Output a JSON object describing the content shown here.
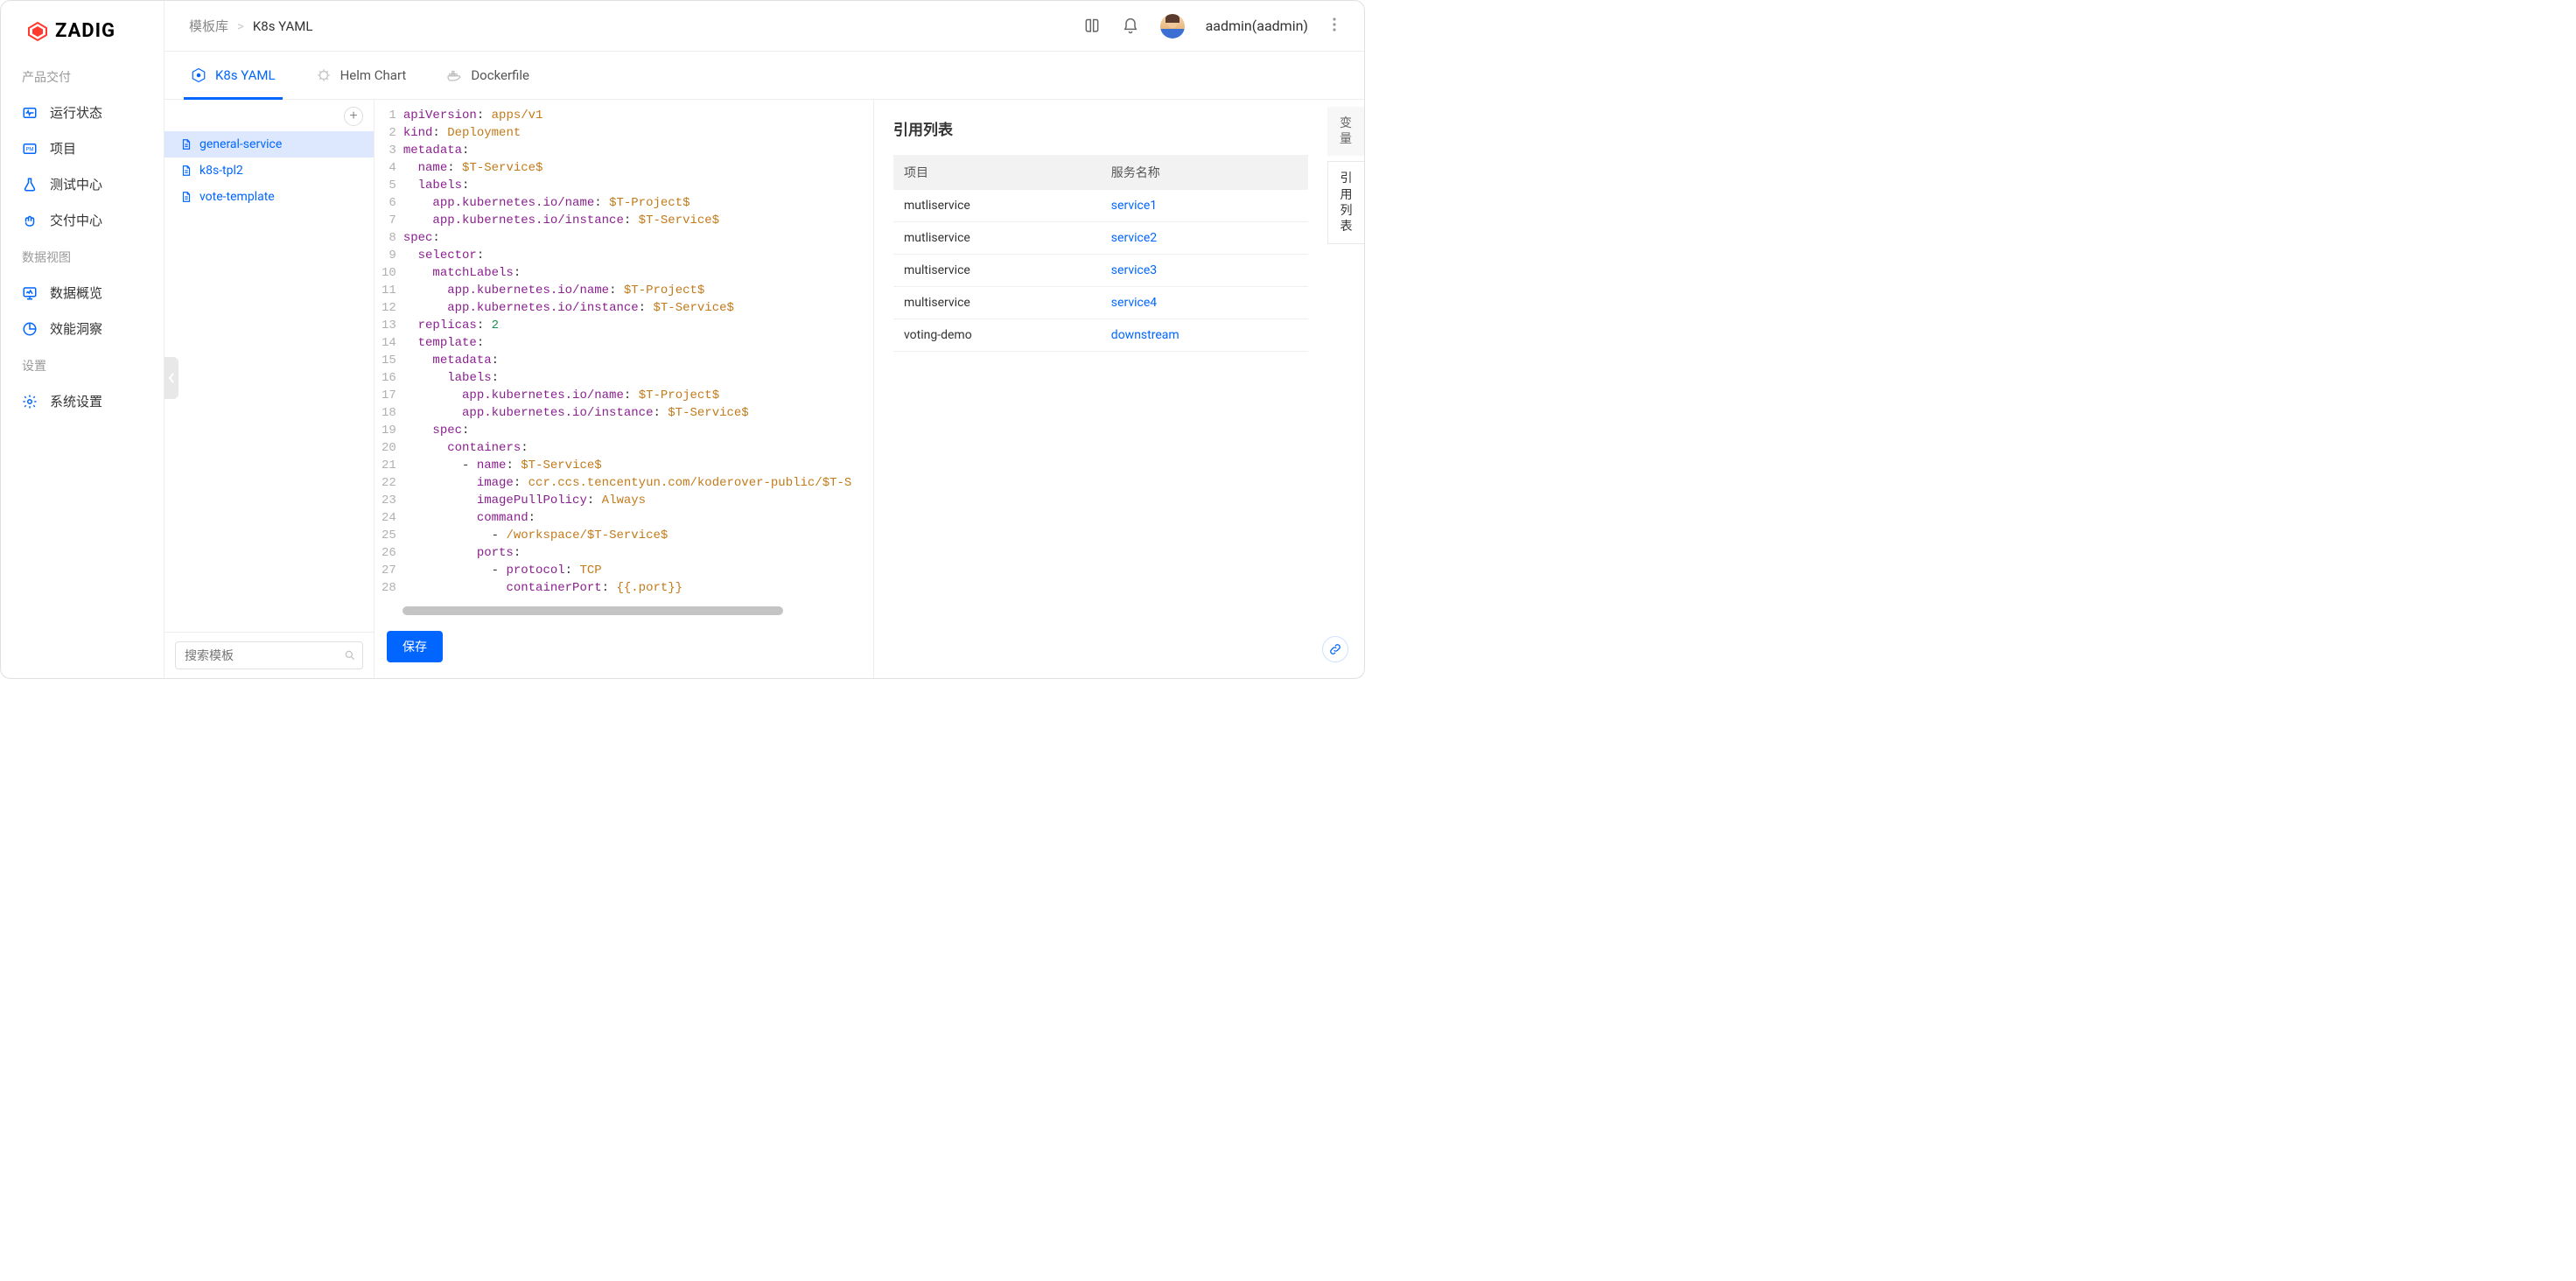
{
  "logo": {
    "text": "ZADIG"
  },
  "breadcrumb": {
    "root": "模板库",
    "current": "K8s YAML"
  },
  "topbar": {
    "username": "aadmin(aadmin)"
  },
  "sidebar": {
    "sections": [
      {
        "title": "产品交付",
        "items": [
          {
            "icon": "heartbeat",
            "label": "运行状态"
          },
          {
            "icon": "project",
            "label": "项目"
          },
          {
            "icon": "flask",
            "label": "测试中心"
          },
          {
            "icon": "hands",
            "label": "交付中心"
          }
        ]
      },
      {
        "title": "数据视图",
        "items": [
          {
            "icon": "monitor",
            "label": "数据概览"
          },
          {
            "icon": "pie",
            "label": "效能洞察"
          }
        ]
      },
      {
        "title": "设置",
        "items": [
          {
            "icon": "gear",
            "label": "系统设置"
          }
        ]
      }
    ]
  },
  "tabs": [
    {
      "icon": "k8s",
      "label": "K8s YAML",
      "active": true
    },
    {
      "icon": "helm",
      "label": "Helm Chart",
      "active": false
    },
    {
      "icon": "docker",
      "label": "Dockerfile",
      "active": false
    }
  ],
  "templates": {
    "items": [
      {
        "name": "general-service",
        "selected": true
      },
      {
        "name": "k8s-tpl2",
        "selected": false
      },
      {
        "name": "vote-template",
        "selected": false
      }
    ],
    "search_placeholder": "搜索模板"
  },
  "editor": {
    "save_label": "保存",
    "code_lines": [
      [
        [
          "key",
          "apiVersion"
        ],
        [
          "punc",
          ": "
        ],
        [
          "str",
          "apps/v1"
        ]
      ],
      [
        [
          "key",
          "kind"
        ],
        [
          "punc",
          ": "
        ],
        [
          "str",
          "Deployment"
        ]
      ],
      [
        [
          "key",
          "metadata"
        ],
        [
          "punc",
          ":"
        ]
      ],
      [
        [
          "txt",
          "  "
        ],
        [
          "key",
          "name"
        ],
        [
          "punc",
          ": "
        ],
        [
          "str",
          "$T-Service$"
        ]
      ],
      [
        [
          "txt",
          "  "
        ],
        [
          "key",
          "labels"
        ],
        [
          "punc",
          ":"
        ]
      ],
      [
        [
          "txt",
          "    "
        ],
        [
          "key",
          "app.kubernetes.io/name"
        ],
        [
          "punc",
          ": "
        ],
        [
          "str",
          "$T-Project$"
        ]
      ],
      [
        [
          "txt",
          "    "
        ],
        [
          "key",
          "app.kubernetes.io/instance"
        ],
        [
          "punc",
          ": "
        ],
        [
          "str",
          "$T-Service$"
        ]
      ],
      [
        [
          "key",
          "spec"
        ],
        [
          "punc",
          ":"
        ]
      ],
      [
        [
          "txt",
          "  "
        ],
        [
          "key",
          "selector"
        ],
        [
          "punc",
          ":"
        ]
      ],
      [
        [
          "txt",
          "    "
        ],
        [
          "key",
          "matchLabels"
        ],
        [
          "punc",
          ":"
        ]
      ],
      [
        [
          "txt",
          "      "
        ],
        [
          "key",
          "app.kubernetes.io/name"
        ],
        [
          "punc",
          ": "
        ],
        [
          "str",
          "$T-Project$"
        ]
      ],
      [
        [
          "txt",
          "      "
        ],
        [
          "key",
          "app.kubernetes.io/instance"
        ],
        [
          "punc",
          ": "
        ],
        [
          "str",
          "$T-Service$"
        ]
      ],
      [
        [
          "txt",
          "  "
        ],
        [
          "key",
          "replicas"
        ],
        [
          "punc",
          ": "
        ],
        [
          "num",
          "2"
        ]
      ],
      [
        [
          "txt",
          "  "
        ],
        [
          "key",
          "template"
        ],
        [
          "punc",
          ":"
        ]
      ],
      [
        [
          "txt",
          "    "
        ],
        [
          "key",
          "metadata"
        ],
        [
          "punc",
          ":"
        ]
      ],
      [
        [
          "txt",
          "      "
        ],
        [
          "key",
          "labels"
        ],
        [
          "punc",
          ":"
        ]
      ],
      [
        [
          "txt",
          "        "
        ],
        [
          "key",
          "app.kubernetes.io/name"
        ],
        [
          "punc",
          ": "
        ],
        [
          "str",
          "$T-Project$"
        ]
      ],
      [
        [
          "txt",
          "        "
        ],
        [
          "key",
          "app.kubernetes.io/instance"
        ],
        [
          "punc",
          ": "
        ],
        [
          "str",
          "$T-Service$"
        ]
      ],
      [
        [
          "txt",
          "    "
        ],
        [
          "key",
          "spec"
        ],
        [
          "punc",
          ":"
        ]
      ],
      [
        [
          "txt",
          "      "
        ],
        [
          "key",
          "containers"
        ],
        [
          "punc",
          ":"
        ]
      ],
      [
        [
          "txt",
          "        "
        ],
        [
          "punc",
          "- "
        ],
        [
          "key",
          "name"
        ],
        [
          "punc",
          ": "
        ],
        [
          "str",
          "$T-Service$"
        ]
      ],
      [
        [
          "txt",
          "          "
        ],
        [
          "key",
          "image"
        ],
        [
          "punc",
          ": "
        ],
        [
          "str",
          "ccr.ccs.tencentyun.com/koderover-public/$T-S"
        ]
      ],
      [
        [
          "txt",
          "          "
        ],
        [
          "key",
          "imagePullPolicy"
        ],
        [
          "punc",
          ": "
        ],
        [
          "str",
          "Always"
        ]
      ],
      [
        [
          "txt",
          "          "
        ],
        [
          "key",
          "command"
        ],
        [
          "punc",
          ":"
        ]
      ],
      [
        [
          "txt",
          "            "
        ],
        [
          "punc",
          "- "
        ],
        [
          "str",
          "/workspace/$T-Service$"
        ]
      ],
      [
        [
          "txt",
          "          "
        ],
        [
          "key",
          "ports"
        ],
        [
          "punc",
          ":"
        ]
      ],
      [
        [
          "txt",
          "            "
        ],
        [
          "punc",
          "- "
        ],
        [
          "key",
          "protocol"
        ],
        [
          "punc",
          ": "
        ],
        [
          "str",
          "TCP"
        ]
      ],
      [
        [
          "txt",
          "              "
        ],
        [
          "key",
          "containerPort"
        ],
        [
          "punc",
          ": "
        ],
        [
          "str",
          "{{.port}}"
        ]
      ]
    ]
  },
  "right": {
    "title": "引用列表",
    "table": {
      "col_project": "项目",
      "col_service": "服务名称",
      "rows": [
        {
          "project": "mutliservice",
          "service": "service1"
        },
        {
          "project": "mutliservice",
          "service": "service2"
        },
        {
          "project": "multiservice",
          "service": "service3"
        },
        {
          "project": "multiservice",
          "service": "service4"
        },
        {
          "project": "voting-demo",
          "service": "downstream"
        }
      ]
    },
    "vtabs": [
      {
        "label": "变量",
        "active": false
      },
      {
        "label": "引用列表",
        "active": true
      }
    ]
  }
}
